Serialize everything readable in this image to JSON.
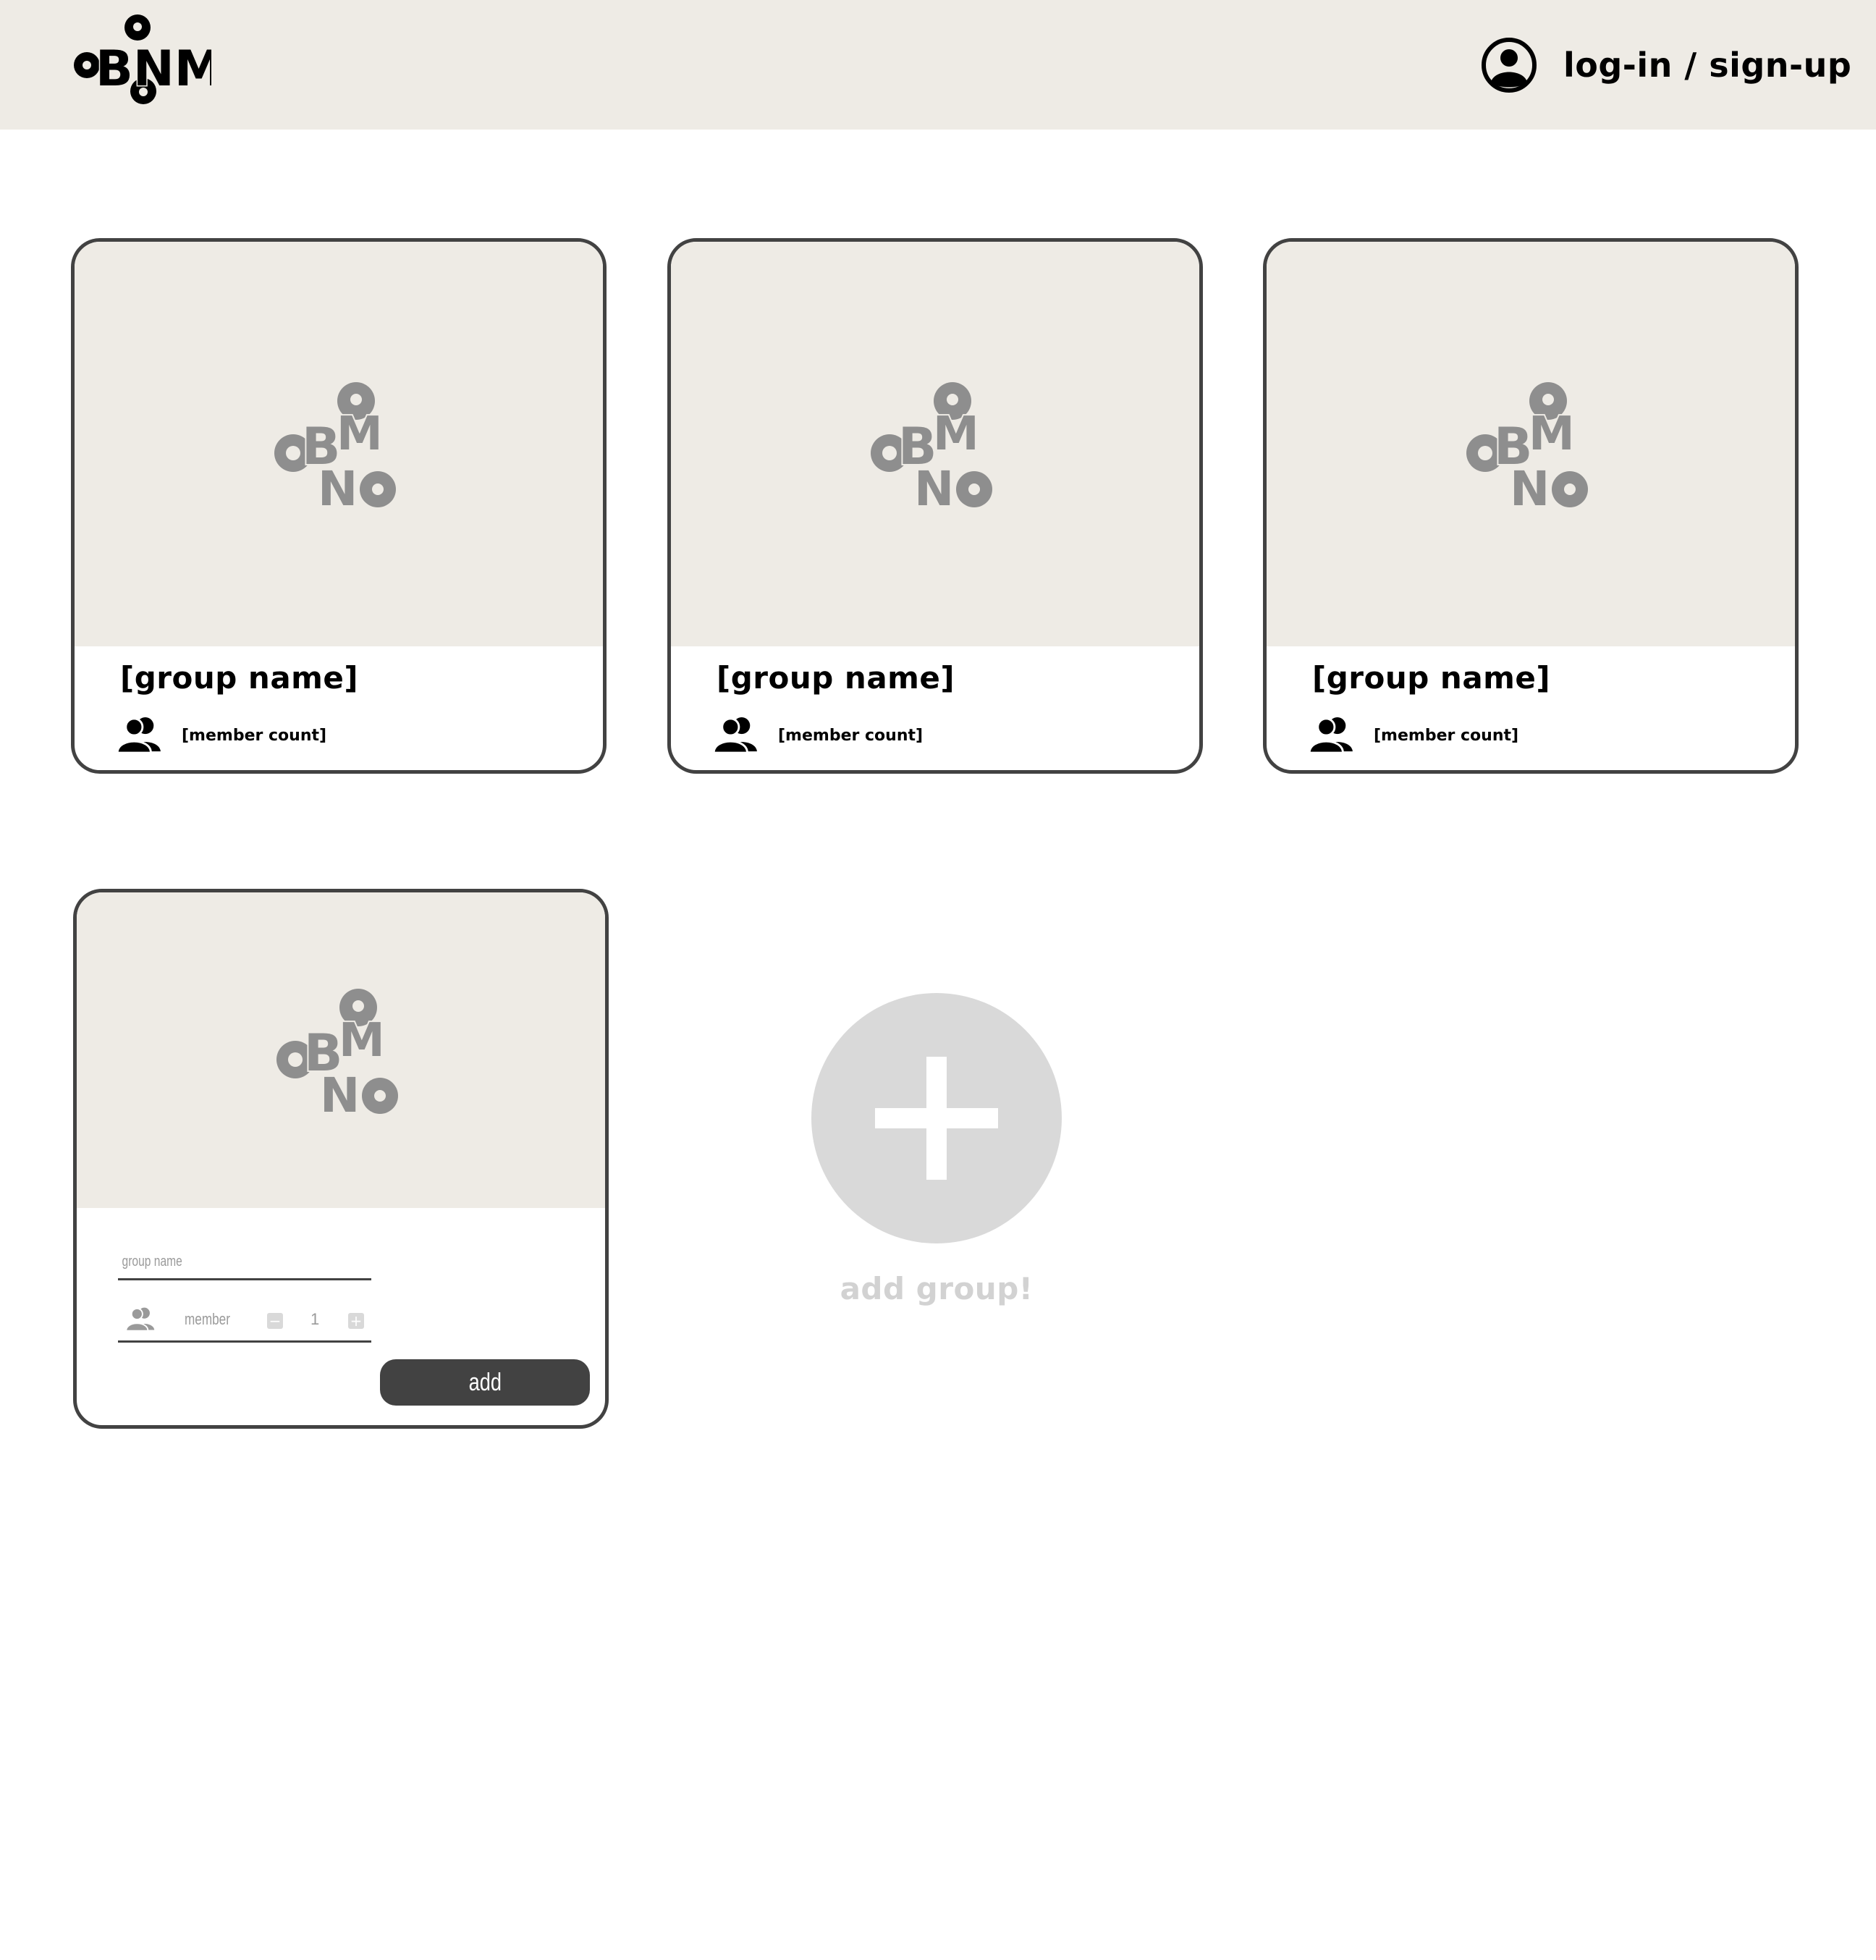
{
  "header": {
    "logo": "cBNM",
    "account_label": "log-in / sign-up",
    "account_icon": "user-circle-icon"
  },
  "groups": [
    {
      "name": "[group name]",
      "members": "[member count]"
    },
    {
      "name": "[group name]",
      "members": "[member count]"
    },
    {
      "name": "[group name]",
      "members": "[member count]"
    }
  ],
  "form": {
    "group_placeholder": "group name",
    "member_label": "member",
    "member_value": "1",
    "minus": "−",
    "plus": "+",
    "submit_label": "add"
  },
  "add_group": {
    "label": "add group!"
  },
  "colors": {
    "header_bg": "#eeebe5",
    "card_border": "#424242",
    "placeholder_grey": "#9a9a9a",
    "add_circle": "#d9d9d9"
  }
}
